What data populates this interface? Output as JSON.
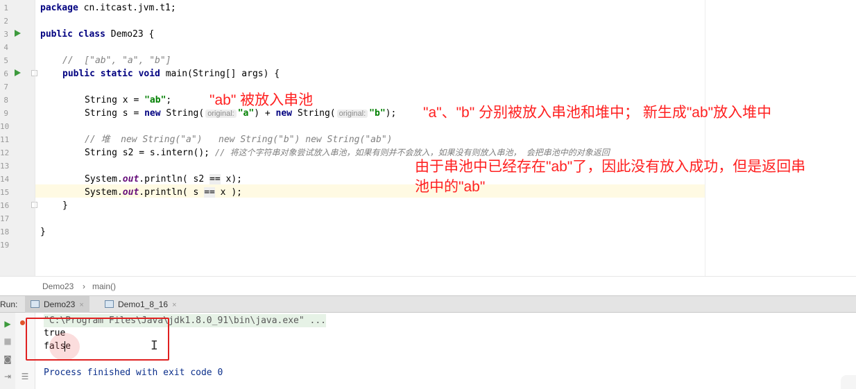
{
  "editor": {
    "line_numbers": [
      "1",
      "2",
      "3",
      "4",
      "5",
      "6",
      "7",
      "8",
      "9",
      "10",
      "11",
      "12",
      "13",
      "14",
      "15",
      "16",
      "17",
      "18",
      "19"
    ],
    "lines": {
      "l1_kw": "package",
      "l1_rest": " cn.itcast.jvm.t1;",
      "l3_kw": "public class",
      "l3_rest": " Demo23 {",
      "l5_comment": "//  [\"ab\", \"a\", \"b\"]",
      "l6_kw": "public static void",
      "l6_rest": " main(String[] args) {",
      "l8_pre": "String x = ",
      "l8_str": "\"ab\"",
      "l8_post": ";",
      "l9_pre": "String s = ",
      "l9_new1": "new",
      "l9_mid1": " String(",
      "l9_hint1": "original:",
      "l9_str1": "\"a\"",
      "l9_mid2": ") + ",
      "l9_new2": "new",
      "l9_mid3": " String(",
      "l9_hint2": "original:",
      "l9_str2": "\"b\"",
      "l9_end": ");",
      "l11_comment": "// 堆  new String(\"a\")   new String(\"b\") new String(\"ab\")",
      "l12_code": "String s2 = s.intern(); ",
      "l12_comment": "// 将这个字符串对象尝试放入串池，如果有则并不会放入，如果没有则放入串池， 会把串池中的对象返回",
      "l14_pre": "System.",
      "l14_out": "out",
      "l14_post1": ".println( s2 ",
      "l14_op": "==",
      "l14_post2": " x);",
      "l15_pre": "System.",
      "l15_out": "out",
      "l15_post1": ".println( s ",
      "l15_op": "==",
      "l15_post2": " x );",
      "l16": "}",
      "l18": "}"
    }
  },
  "annotations": {
    "a1": "\"ab\" 被放入串池",
    "a2": "\"a\"、\"b\" 分别被放入串池和堆中；  新生成\"ab\"放入堆中",
    "a3_line1": "由于串池中已经存在\"ab\"了，因此没有放入成功，但是返回串",
    "a3_line2": "池中的\"ab\""
  },
  "breadcrumb": {
    "class": "Demo23",
    "separator": "›",
    "method": "main()"
  },
  "run_panel": {
    "label": "Run:",
    "tabs": [
      {
        "label": "Demo23",
        "active": true
      },
      {
        "label": "Demo1_8_16",
        "active": false
      }
    ],
    "close_glyph": "×"
  },
  "console": {
    "command": "\"C:\\Program Files\\Java\\jdk1.8.0_91\\bin\\java.exe\" ...",
    "output": [
      "true",
      "false"
    ],
    "exit_message": "Process finished with exit code 0"
  },
  "colors": {
    "annotation": "#ff2020",
    "keyword": "#000080",
    "string": "#008000",
    "comment": "#808080",
    "run_green": "#3d9a3d"
  }
}
